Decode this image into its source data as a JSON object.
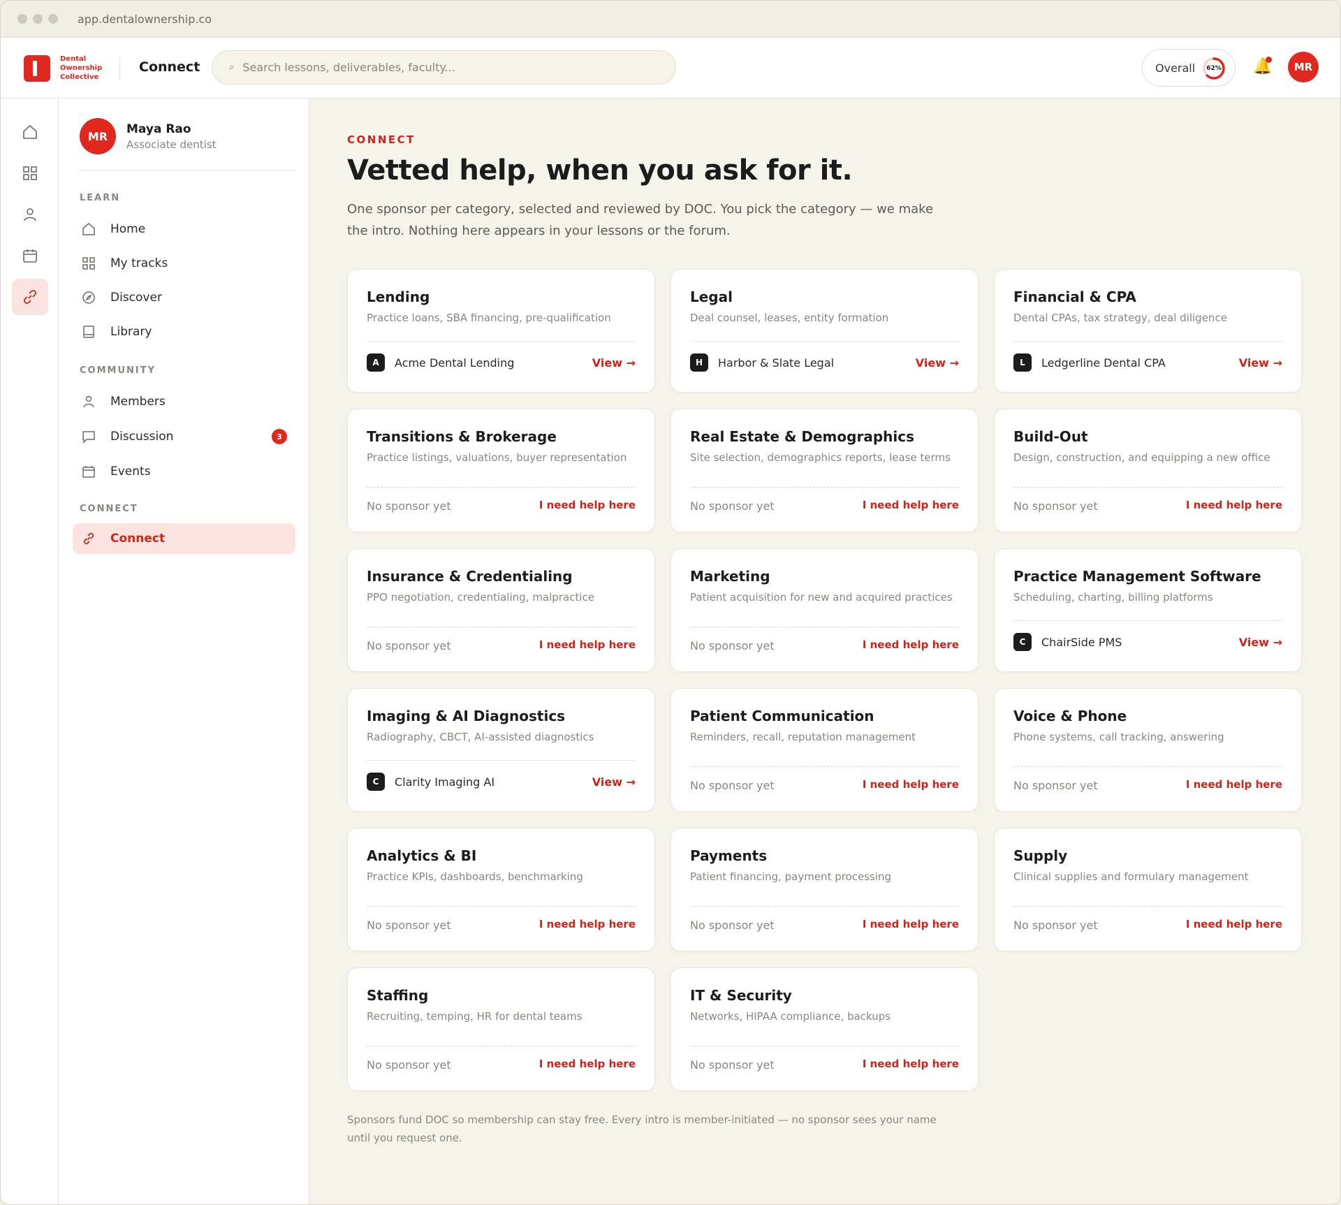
{
  "browser": {
    "url": "app.dentalownership.co"
  },
  "header": {
    "logo_lines": [
      "Dental",
      "Ownership",
      "Collective"
    ],
    "section": "Connect",
    "search_placeholder": "Search lessons, deliverables, faculty...",
    "overall_label": "Overall",
    "overall_progress_text": "62%",
    "overall_progress": 0.62,
    "avatar_initials": "MR"
  },
  "sidebar": {
    "user": {
      "initials": "MR",
      "name": "Maya Rao",
      "role": "Associate dentist"
    },
    "groups": [
      {
        "label": "LEARN",
        "items": [
          {
            "label": "Home",
            "icon": "home-icon"
          },
          {
            "label": "My tracks",
            "icon": "grid-icon"
          },
          {
            "label": "Discover",
            "icon": "compass-icon"
          },
          {
            "label": "Library",
            "icon": "book-icon"
          }
        ]
      },
      {
        "label": "COMMUNITY",
        "items": [
          {
            "label": "Members",
            "icon": "user-icon"
          },
          {
            "label": "Discussion",
            "icon": "chat-icon",
            "badge": "3"
          },
          {
            "label": "Events",
            "icon": "calendar-icon"
          }
        ]
      },
      {
        "label": "CONNECT",
        "items": [
          {
            "label": "Connect",
            "icon": "link-icon",
            "active": true
          }
        ]
      }
    ]
  },
  "main": {
    "eyebrow": "CONNECT",
    "headline": "Vetted help, when you ask for it.",
    "intro": "One sponsor per category, selected and reviewed by DOC. You pick the category — we make the intro. Nothing here appears in your lessons or the forum.",
    "view_label": "View →",
    "no_sponsor_label": "No sponsor yet",
    "help_label": "I need help here",
    "categories": [
      {
        "title": "Lending",
        "desc": "Practice loans, SBA financing, pre-qualification",
        "sponsor": "Acme Dental Lending",
        "initial": "A"
      },
      {
        "title": "Legal",
        "desc": "Deal counsel, leases, entity formation",
        "sponsor": "Harbor & Slate Legal",
        "initial": "H"
      },
      {
        "title": "Financial & CPA",
        "desc": "Dental CPAs, tax strategy, deal diligence",
        "sponsor": "Ledgerline Dental CPA",
        "initial": "L"
      },
      {
        "title": "Transitions & Brokerage",
        "desc": "Practice listings, valuations, buyer representation",
        "sponsor": null
      },
      {
        "title": "Real Estate & Demographics",
        "desc": "Site selection, demographics reports, lease terms",
        "sponsor": null
      },
      {
        "title": "Build-Out",
        "desc": "Design, construction, and equipping a new office",
        "sponsor": null
      },
      {
        "title": "Insurance & Credentialing",
        "desc": "PPO negotiation, credentialing, malpractice",
        "sponsor": null
      },
      {
        "title": "Marketing",
        "desc": "Patient acquisition for new and acquired practices",
        "sponsor": null
      },
      {
        "title": "Practice Management Software",
        "desc": "Scheduling, charting, billing platforms",
        "sponsor": "ChairSide PMS",
        "initial": "C"
      },
      {
        "title": "Imaging & AI Diagnostics",
        "desc": "Radiography, CBCT, AI-assisted diagnostics",
        "sponsor": "Clarity Imaging AI",
        "initial": "C"
      },
      {
        "title": "Patient Communication",
        "desc": "Reminders, recall, reputation management",
        "sponsor": null
      },
      {
        "title": "Voice & Phone",
        "desc": "Phone systems, call tracking, answering",
        "sponsor": null
      },
      {
        "title": "Analytics & BI",
        "desc": "Practice KPIs, dashboards, benchmarking",
        "sponsor": null
      },
      {
        "title": "Payments",
        "desc": "Patient financing, payment processing",
        "sponsor": null
      },
      {
        "title": "Supply",
        "desc": "Clinical supplies and formulary management",
        "sponsor": null
      },
      {
        "title": "Staffing",
        "desc": "Recruiting, temping, HR for dental teams",
        "sponsor": null
      },
      {
        "title": "IT & Security",
        "desc": "Networks, HIPAA compliance, backups",
        "sponsor": null
      }
    ],
    "footnote": "Sponsors fund DOC so membership can stay free. Every intro is member-initiated — no sponsor sees your name until you request one."
  },
  "colors": {
    "accent": "#e0281f",
    "link": "#d0241b",
    "background": "#f6f3ea"
  }
}
